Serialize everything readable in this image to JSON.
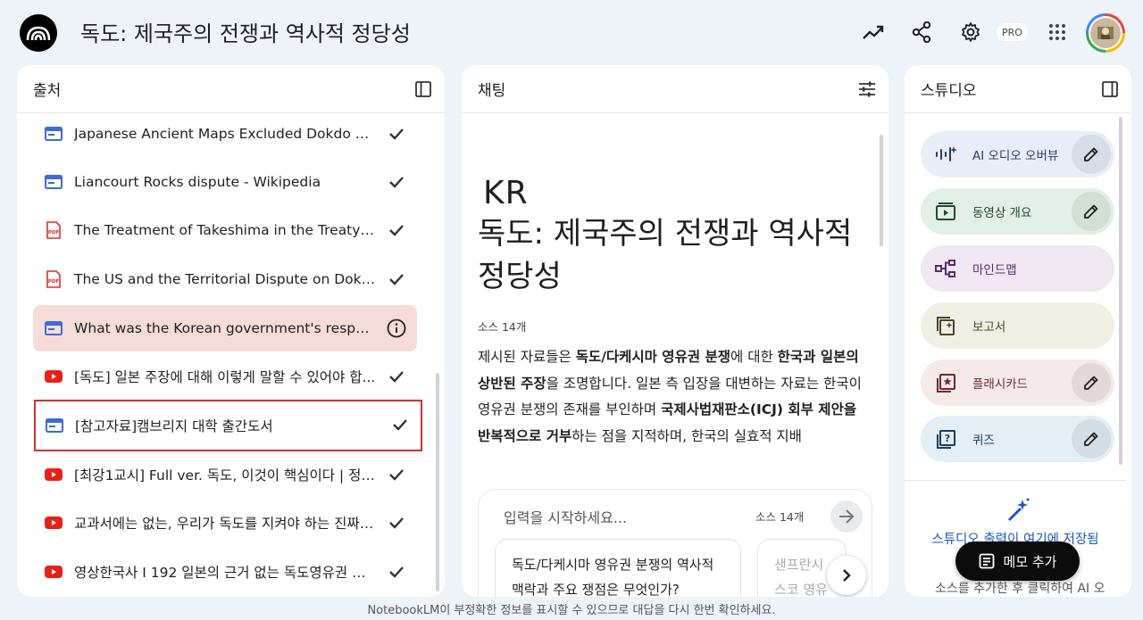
{
  "app": {
    "title": "독도: 제국주의 전쟁과 역사적 정당성",
    "badge": "PRO",
    "footer": "NotebookLM이 부정확한 정보를 표시할 수 있으므로 대답을 다시 한번 확인하세요."
  },
  "sources": {
    "title": "출처",
    "items": [
      {
        "label": "Japanese Ancient Maps Excluded Dokdo – T...",
        "icon": "web-icon",
        "state": "checked"
      },
      {
        "label": "Liancourt Rocks dispute - Wikipedia",
        "icon": "web-icon",
        "state": "checked"
      },
      {
        "label": "The Treatment of Takeshima in the Treaty of ...",
        "icon": "pdf-icon",
        "state": "checked"
      },
      {
        "label": "The US and the Territorial Dispute on Dokdo/...",
        "icon": "pdf-icon",
        "state": "checked"
      },
      {
        "label": "What was the Korean government's response...",
        "icon": "web-icon",
        "state": "info"
      },
      {
        "label": "[독도] 일본 주장에 대해 이렇게 말할 수 있어야 합...",
        "icon": "youtube-icon",
        "state": "checked"
      },
      {
        "label": "[참고자료]캠브리지 대학 출간도서",
        "icon": "web-icon",
        "state": "checked"
      },
      {
        "label": "[최강1교시] Full ver. 독도, 이것이 핵심이다 | 정치...",
        "icon": "youtube-icon",
        "state": "checked"
      },
      {
        "label": "교과서에는 없는, 우리가 독도를 지켜야 하는 진짜 ...",
        "icon": "youtube-icon",
        "state": "checked"
      },
      {
        "label": "영상한국사 I 192 일본의 근거 없는 독도영유권 주장",
        "icon": "youtube-icon",
        "state": "checked"
      }
    ]
  },
  "chat": {
    "title": "채팅",
    "emoji_label": "KR",
    "notebook_title": "독도: 제국주의 전쟁과 역사적 정당성",
    "source_count": "소스 14개",
    "summary": {
      "p1": "제시된 자료들은 ",
      "b1": "독도/다케시마 영유권 분쟁",
      "p2": "에 대한 ",
      "b2": "한국과 일본의 상반된 주장",
      "p3": "을 조명합니다. 일본 측 입장을 대변하는 자료는 한국이 영유권 분쟁의 존재를 부인하며 ",
      "b3": "국제사법재판소(ICJ) 회부 제안을 반복적으로 거부",
      "p4": "하는 점을 지적하며, 한국의 실효적 지배"
    },
    "input_placeholder": "입력을 시작하세요...",
    "input_count": "소스 14개",
    "suggestions": [
      "독도/다케시마 영유권 분쟁의 역사적 맥락과 주요 쟁점은 무엇인가?",
      "샌프란시스코 영유권 ..."
    ]
  },
  "studio": {
    "title": "스튜디오",
    "cards": [
      {
        "label": "AI 오디오 오버뷰",
        "icon": "audio-waveform-icon",
        "color": "#e8edf8",
        "fg": "#2b3a6b",
        "editable": true
      },
      {
        "label": "동영상 개요",
        "icon": "video-icon",
        "color": "#e3efe6",
        "fg": "#1e4a2e",
        "editable": true
      },
      {
        "label": "마인드맵",
        "icon": "mindmap-icon",
        "color": "#efe8f3",
        "fg": "#5b2a6e",
        "editable": false
      },
      {
        "label": "보고서",
        "icon": "report-icon",
        "color": "#f0efe4",
        "fg": "#4a4528",
        "editable": false
      },
      {
        "label": "플래시카드",
        "icon": "flashcard-icon",
        "color": "#f5e9e9",
        "fg": "#6e2a35",
        "editable": true
      },
      {
        "label": "퀴즈",
        "icon": "quiz-icon",
        "color": "#e3eef5",
        "fg": "#1e3e55",
        "editable": true
      }
    ],
    "saved_msg": "스튜디오 출력이 여기에 저장됨",
    "sub_msg": "소스를 추가한 후 클릭하여 AI 오",
    "memo_button": "메모 추가"
  }
}
